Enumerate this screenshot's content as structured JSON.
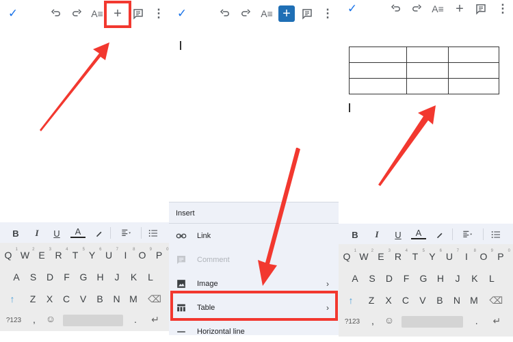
{
  "toolbar": {
    "done_icon": "check-icon",
    "undo_icon": "undo-icon",
    "redo_icon": "redo-icon",
    "format_icon": "text-format-icon",
    "insert_icon": "plus-icon",
    "comment_icon": "comment-icon",
    "more_icon": "more-vert-icon",
    "check_glyph": "✓",
    "plus_glyph": "+",
    "more_glyph": "⋮"
  },
  "format_bar": {
    "bold": "B",
    "italic": "I",
    "underline": "U",
    "text_color": "A",
    "highlight_icon": "pen-icon",
    "align_icon": "align-left-icon",
    "list_icon": "bullet-list-icon"
  },
  "keyboard": {
    "row1": [
      {
        "k": "Q",
        "n": "1"
      },
      {
        "k": "W",
        "n": "2"
      },
      {
        "k": "E",
        "n": "3"
      },
      {
        "k": "R",
        "n": "4"
      },
      {
        "k": "T",
        "n": "5"
      },
      {
        "k": "Y",
        "n": "6"
      },
      {
        "k": "U",
        "n": "7"
      },
      {
        "k": "I",
        "n": "8"
      },
      {
        "k": "O",
        "n": "9"
      },
      {
        "k": "P",
        "n": "0"
      }
    ],
    "row2": [
      "A",
      "S",
      "D",
      "F",
      "G",
      "H",
      "J",
      "K",
      "L"
    ],
    "row3": [
      "Z",
      "X",
      "C",
      "V",
      "B",
      "N",
      "M"
    ],
    "shift": "↑",
    "backspace": "⌫",
    "symbols": "?123",
    "comma": ",",
    "emoji": "☺",
    "period": ".",
    "enter": "↵"
  },
  "insert_menu": {
    "title": "Insert",
    "items": [
      {
        "label": "Link",
        "icon": "link-icon",
        "enabled": true,
        "submenu": false
      },
      {
        "label": "Comment",
        "icon": "comment-icon",
        "enabled": false,
        "submenu": false
      },
      {
        "label": "Image",
        "icon": "image-icon",
        "enabled": true,
        "submenu": true
      },
      {
        "label": "Table",
        "icon": "table-icon",
        "enabled": true,
        "submenu": true
      },
      {
        "label": "Horizontal line",
        "icon": "horizontal-line-icon",
        "enabled": true,
        "submenu": false
      }
    ],
    "chevron": "›"
  },
  "document_table": {
    "rows": 3,
    "cols": 3
  },
  "annotation_color": "#f2382f",
  "accent_color": "#1f6fb5"
}
